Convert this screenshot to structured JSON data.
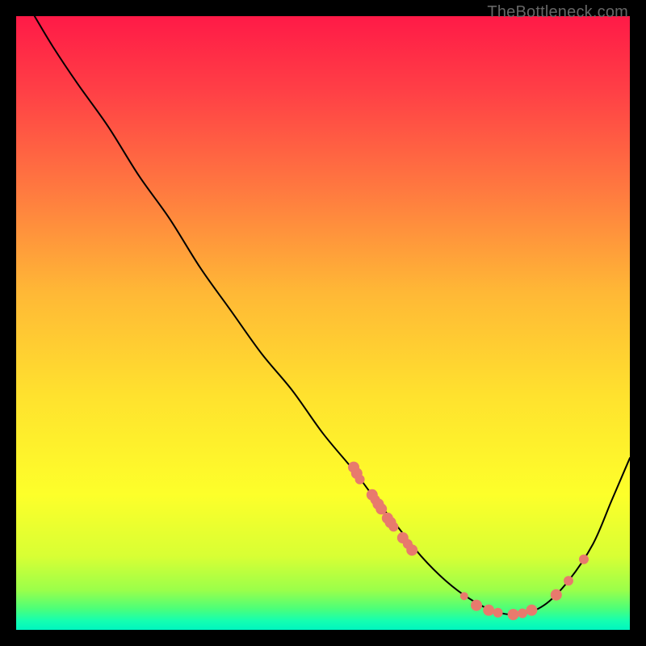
{
  "watermark": "TheBottleneck.com",
  "colors": {
    "curve_stroke": "#000000",
    "point_fill": "#e87a6d",
    "gradient_stops": [
      {
        "offset": 0.0,
        "color": "#ff1a47"
      },
      {
        "offset": 0.12,
        "color": "#ff3f46"
      },
      {
        "offset": 0.28,
        "color": "#ff7840"
      },
      {
        "offset": 0.45,
        "color": "#ffb836"
      },
      {
        "offset": 0.62,
        "color": "#ffe22e"
      },
      {
        "offset": 0.78,
        "color": "#fdff2a"
      },
      {
        "offset": 0.88,
        "color": "#d8ff34"
      },
      {
        "offset": 0.935,
        "color": "#9bff4a"
      },
      {
        "offset": 0.965,
        "color": "#4dff78"
      },
      {
        "offset": 0.985,
        "color": "#15ffb0"
      },
      {
        "offset": 1.0,
        "color": "#00f5c0"
      }
    ]
  },
  "chart_data": {
    "type": "line",
    "title": "",
    "xlabel": "",
    "ylabel": "",
    "xlim": [
      0,
      100
    ],
    "ylim": [
      0,
      100
    ],
    "note": "x/y in percent of plot width/height; y=0 is top, y=100 is bottom (curve dips toward bottom = optimal).",
    "series": [
      {
        "name": "bottleneck-curve",
        "x": [
          3,
          6,
          10,
          15,
          20,
          25,
          30,
          35,
          40,
          45,
          50,
          55,
          58,
          62,
          66,
          70,
          74,
          78,
          82,
          86,
          90,
          94,
          97,
          100
        ],
        "y": [
          0,
          5,
          11,
          18,
          26,
          33,
          41,
          48,
          55,
          61,
          68,
          74,
          78,
          83,
          88,
          92,
          95,
          97,
          97.5,
          96,
          92,
          86,
          79,
          72
        ]
      }
    ],
    "points": {
      "name": "highlighted-configs",
      "xy": [
        [
          55,
          73.5
        ],
        [
          55.5,
          74.5
        ],
        [
          56,
          75.5
        ],
        [
          58,
          78
        ],
        [
          58.5,
          78.8
        ],
        [
          59,
          79.5
        ],
        [
          59.5,
          80.3
        ],
        [
          60.5,
          81.8
        ],
        [
          61,
          82.5
        ],
        [
          61.5,
          83.2
        ],
        [
          63,
          85
        ],
        [
          63.8,
          86
        ],
        [
          64.5,
          87
        ],
        [
          73,
          94.5
        ],
        [
          75,
          96
        ],
        [
          77,
          96.8
        ],
        [
          78.5,
          97.2
        ],
        [
          81,
          97.5
        ],
        [
          82.5,
          97.3
        ],
        [
          84,
          96.8
        ],
        [
          88,
          94.3
        ],
        [
          90,
          92
        ],
        [
          92.5,
          88.5
        ]
      ],
      "radii": [
        7,
        7,
        6,
        7,
        6,
        7,
        7,
        7,
        7,
        6,
        7,
        6,
        7,
        5,
        7,
        7,
        6,
        7,
        6,
        7,
        7,
        6,
        6
      ]
    }
  }
}
